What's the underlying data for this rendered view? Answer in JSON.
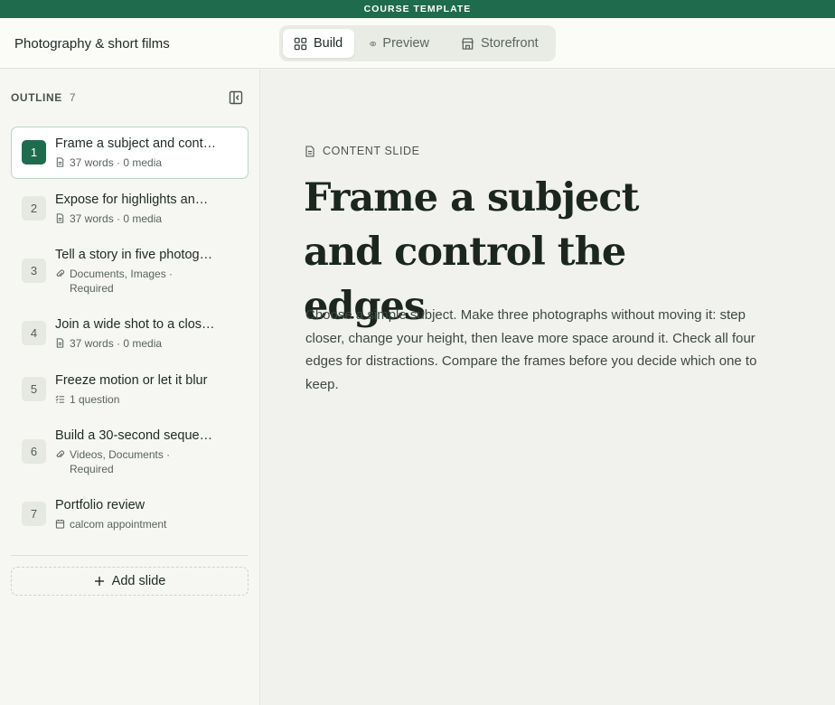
{
  "banner": {
    "label": "COURSE TEMPLATE"
  },
  "header": {
    "course_title": "Photography & short films",
    "modes": [
      {
        "label": "Build",
        "icon": "grid-icon",
        "active": true
      },
      {
        "label": "Preview",
        "icon": "eye-icon",
        "active": false
      },
      {
        "label": "Storefront",
        "icon": "storefront-icon",
        "active": false
      }
    ]
  },
  "sidebar": {
    "heading": "OUTLINE",
    "count": "7",
    "slides": [
      {
        "num": "1",
        "title": "Frame a subject and cont…",
        "meta_icon": "document-icon",
        "meta": "37 words · 0 media",
        "active": true
      },
      {
        "num": "2",
        "title": "Expose for highlights an…",
        "meta_icon": "document-icon",
        "meta": "37 words · 0 media"
      },
      {
        "num": "3",
        "title": "Tell a story in five photog…",
        "meta_icon": "paperclip-icon",
        "meta_line1": "Documents, Images ·",
        "meta_line2": "Required"
      },
      {
        "num": "4",
        "title": "Join a wide shot to a clos…",
        "meta_icon": "document-icon",
        "meta": "37 words · 0 media"
      },
      {
        "num": "5",
        "title": "Freeze motion or let it blur",
        "meta_icon": "checklist-icon",
        "meta": "1 question"
      },
      {
        "num": "6",
        "title": "Build a 30-second seque…",
        "meta_icon": "paperclip-icon",
        "meta_line1": "Videos, Documents ·",
        "meta_line2": "Required"
      },
      {
        "num": "7",
        "title": "Portfolio review",
        "meta_icon": "calendar-icon",
        "meta": "calcom appointment"
      }
    ],
    "add_label": "Add slide"
  },
  "main": {
    "slide_type": "CONTENT SLIDE",
    "heading": "Frame a subject and control the edges",
    "body": "Choose a simple subject. Make three photographs without moving it: step closer, change your height, then leave more space around it. Check all four edges for distractions. Compare the frames before you decide which one to keep."
  },
  "colors": {
    "accent": "#1f6b4e",
    "active_border": "#b9d6c8"
  }
}
